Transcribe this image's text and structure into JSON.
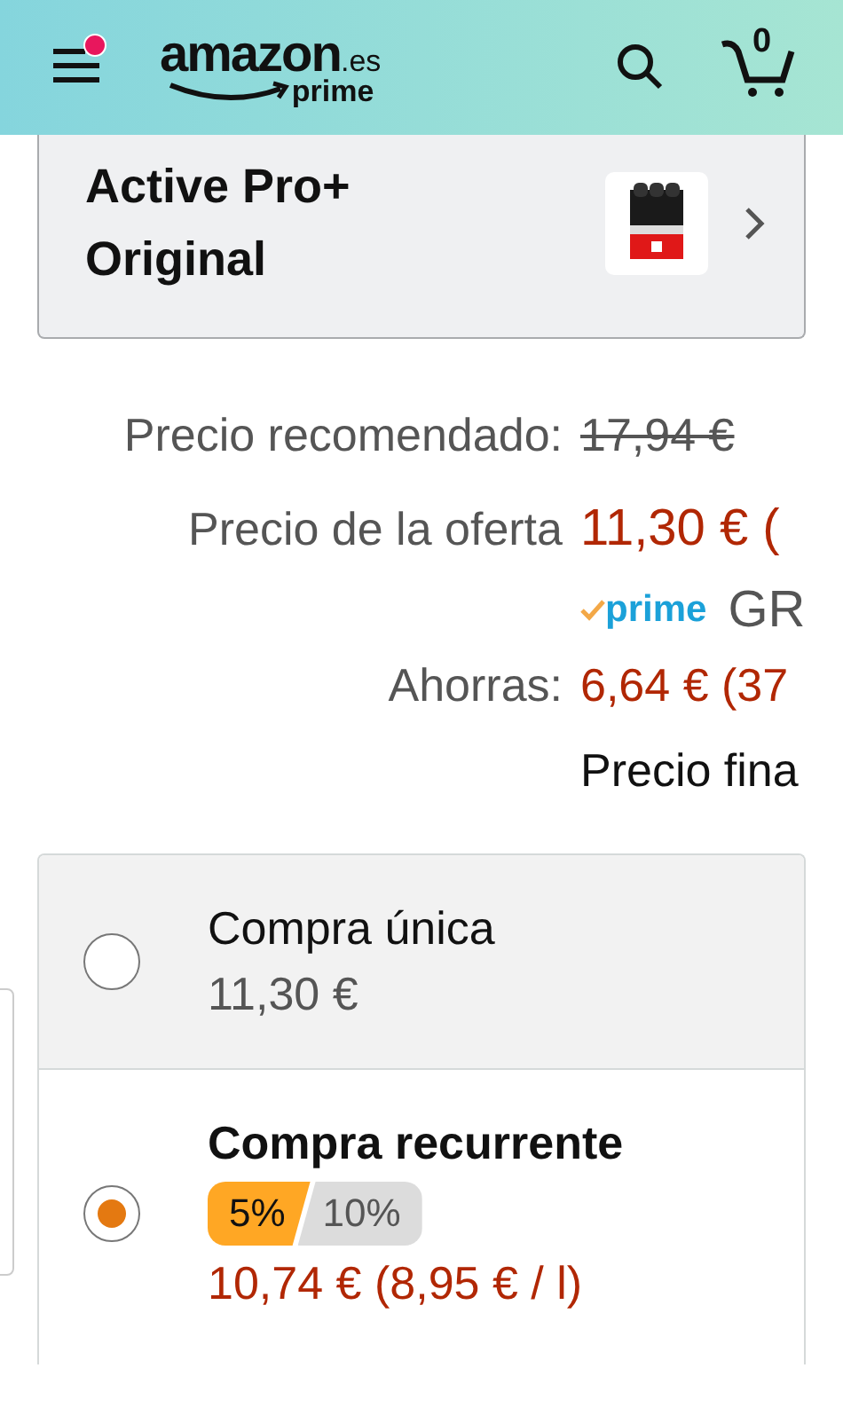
{
  "header": {
    "logo": "amazon",
    "logo_domain": ".es",
    "logo_sub": "prime",
    "cart_count": "0",
    "menu_notification": true
  },
  "variation": {
    "value": "Active Pro+ Original"
  },
  "prices": [
    {
      "kind": "strike",
      "label": "Precio recomendado:",
      "value": "17,94 €"
    },
    {
      "kind": "deal",
      "label": "Precio de la oferta",
      "value": "11,30 € ("
    },
    {
      "kind": "prime",
      "badge": "prime",
      "value": "GR"
    },
    {
      "kind": "deal",
      "label": "Ahorras:",
      "value": "6,64 € (37"
    },
    {
      "kind": "note",
      "value": "Precio fina"
    }
  ],
  "purchase_options": [
    {
      "title": "Compra única",
      "price": "11,30 €",
      "selected": false
    },
    {
      "title": "Compra recurrente",
      "discounts": [
        {
          "label": "5%",
          "selected": true
        },
        {
          "label": "10%",
          "selected": false
        }
      ],
      "price": "10,74 € (8,95 € / l)",
      "selected": true
    }
  ]
}
